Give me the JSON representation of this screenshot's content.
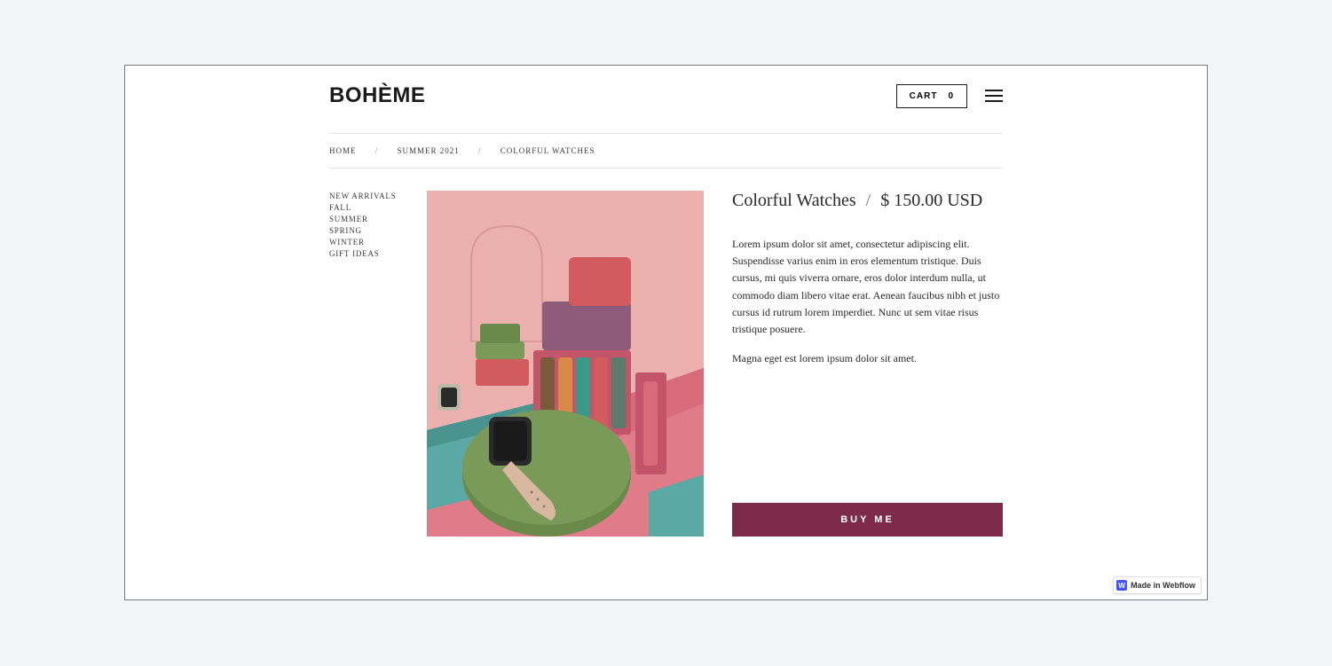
{
  "header": {
    "logo": "BOHÈME",
    "cart_label": "CART",
    "cart_count": "0"
  },
  "breadcrumb": {
    "items": [
      {
        "label": "HOME"
      },
      {
        "label": "SUMMER 2021"
      },
      {
        "label": "COLORFUL WATCHES"
      }
    ],
    "separator": "/"
  },
  "sidebar": {
    "items": [
      {
        "label": "NEW ARRIVALS"
      },
      {
        "label": "FALL"
      },
      {
        "label": "SUMMER"
      },
      {
        "label": "SPRING"
      },
      {
        "label": "WINTER"
      },
      {
        "label": "GIFT IDEAS"
      }
    ]
  },
  "product": {
    "title": "Colorful Watches",
    "price": "$ 150.00 USD",
    "separator": "/",
    "desc1": "Lorem ipsum dolor sit amet, consectetur adipiscing elit. Suspendisse varius enim in eros elementum tristique. Duis cursus, mi quis viverra ornare, eros dolor interdum nulla, ut commodo diam libero vitae erat. Aenean faucibus nibh et justo cursus id rutrum lorem imperdiet. Nunc ut sem vitae risus tristique posuere.",
    "desc2": "Magna eget est lorem ipsum dolor sit amet.",
    "buy_label": "BUY ME"
  },
  "badge": {
    "text": "Made in Webflow"
  },
  "colors": {
    "accent": "#7e2a4a"
  }
}
